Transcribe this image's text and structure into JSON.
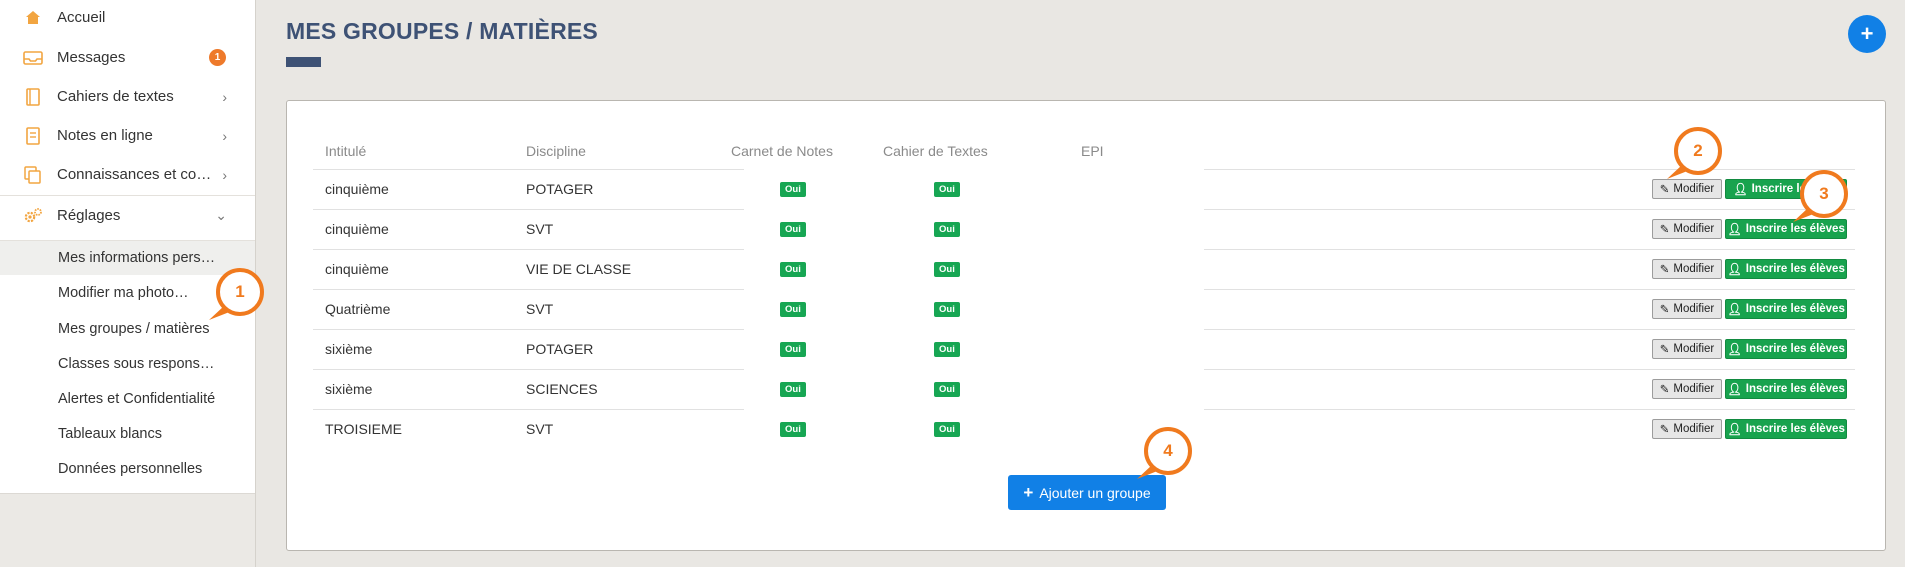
{
  "sidebar": {
    "items": [
      {
        "label": "Accueil",
        "icon": "home-icon"
      },
      {
        "label": "Messages",
        "icon": "inbox-icon",
        "badge": "1"
      },
      {
        "label": "Cahiers de textes",
        "icon": "notebook-icon"
      },
      {
        "label": "Notes en ligne",
        "icon": "notes-icon"
      },
      {
        "label": "Connaissances et comp…",
        "icon": "copy-icon"
      },
      {
        "label": "Réglages",
        "icon": "gears-icon"
      }
    ],
    "sub_items": [
      "Mes informations perso…",
      "Modifier ma photo…",
      "Mes groupes / matières",
      "Classes sous responsa…",
      "Alertes et Confidentialité",
      "Tableaux blancs",
      "Données personnelles"
    ]
  },
  "page": {
    "title": "MES GROUPES / MATIÈRES",
    "add_fab": "+"
  },
  "table": {
    "columns": [
      "Intitulé",
      "Discipline",
      "Carnet de Notes",
      "Cahier de Textes",
      "EPI"
    ],
    "rows": [
      {
        "intitule": "cinquième",
        "discipline": "POTAGER",
        "carnet": "Oui",
        "cahier": "Oui"
      },
      {
        "intitule": "cinquième",
        "discipline": "SVT",
        "carnet": "Oui",
        "cahier": "Oui"
      },
      {
        "intitule": "cinquième",
        "discipline": "VIE DE CLASSE",
        "carnet": "Oui",
        "cahier": "Oui"
      },
      {
        "intitule": "Quatrième",
        "discipline": "SVT",
        "carnet": "Oui",
        "cahier": "Oui"
      },
      {
        "intitule": "sixième",
        "discipline": "POTAGER",
        "carnet": "Oui",
        "cahier": "Oui"
      },
      {
        "intitule": "sixième",
        "discipline": "SCIENCES",
        "carnet": "Oui",
        "cahier": "Oui"
      },
      {
        "intitule": "TROISIEME",
        "discipline": "SVT",
        "carnet": "Oui",
        "cahier": "Oui"
      }
    ],
    "modifier_label": "Modifier",
    "inscrire_label": "Inscrire les élèves",
    "inscrire_label_row1": "Inscrire les"
  },
  "add_group_button": "Ajouter un groupe",
  "callouts": [
    "1",
    "2",
    "3",
    "4"
  ],
  "colors": {
    "accent_blue": "#1180e6",
    "title_navy": "#3e5275",
    "success_green": "#18a34e",
    "callout_orange": "#f07a1e",
    "sidebar_icon": "#f2a541"
  }
}
